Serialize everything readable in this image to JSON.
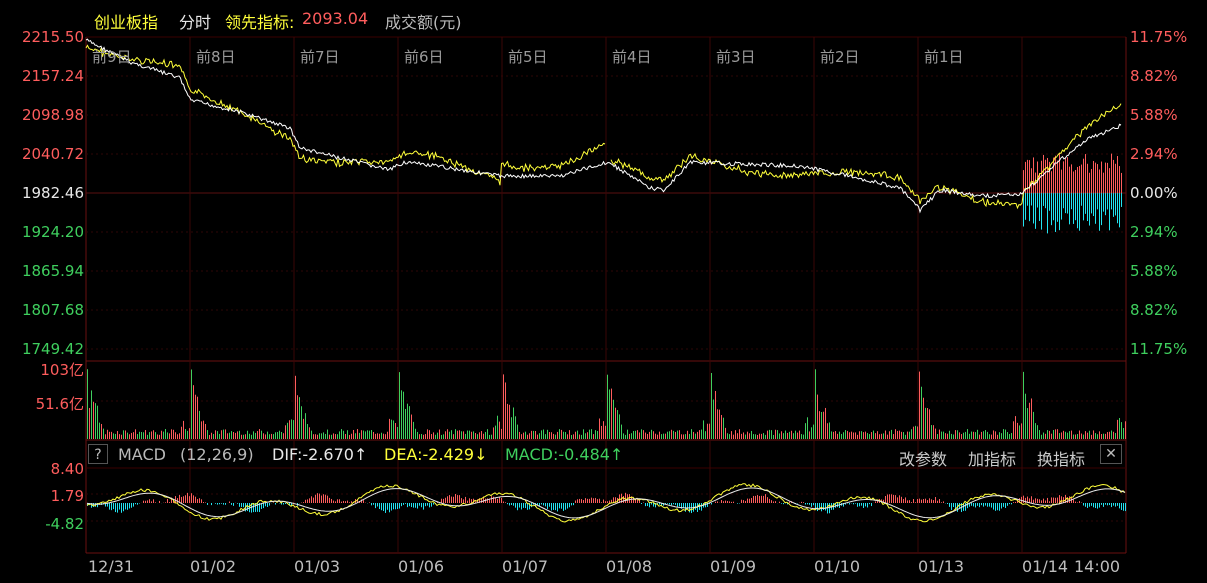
{
  "header": {
    "title": "创业板指",
    "mode": "分时",
    "leading_label": "领先指标:",
    "leading_value": "2093.04",
    "volume_label": "成交额(元)"
  },
  "price_axis": {
    "left": [
      "2215.50",
      "2157.24",
      "2098.98",
      "2040.72",
      "1982.46",
      "1924.20",
      "1865.94",
      "1807.68",
      "1749.42"
    ],
    "right": [
      "11.75%",
      "8.82%",
      "5.88%",
      "2.94%",
      "0.00%",
      "2.94%",
      "5.88%",
      "8.82%",
      "11.75%"
    ]
  },
  "day_labels": [
    "前9日",
    "前8日",
    "前7日",
    "前6日",
    "前5日",
    "前4日",
    "前3日",
    "前2日",
    "前1日"
  ],
  "volume_axis": {
    "max": "103亿",
    "mid": "51.6亿"
  },
  "macd": {
    "help": "?",
    "name": "MACD",
    "params": "(12,26,9)",
    "dif": "DIF:-2.670↑",
    "dea": "DEA:-2.429↓",
    "value": "MACD:-0.484↑",
    "axis": [
      "8.40",
      "1.79",
      "-4.82"
    ],
    "buttons": {
      "modify": "改参数",
      "add": "加指标",
      "switch": "换指标",
      "close": "✕"
    }
  },
  "dates": [
    "12/31",
    "01/02",
    "01/03",
    "01/06",
    "01/07",
    "01/08",
    "01/09",
    "01/10",
    "01/13",
    "01/14",
    "14:00"
  ],
  "colors": {
    "up": "#ff5d5d",
    "down": "#3fcf5e",
    "price": "#ffffff",
    "lead": "#ffff3a",
    "macd_neg": "#22e3f0"
  }
}
